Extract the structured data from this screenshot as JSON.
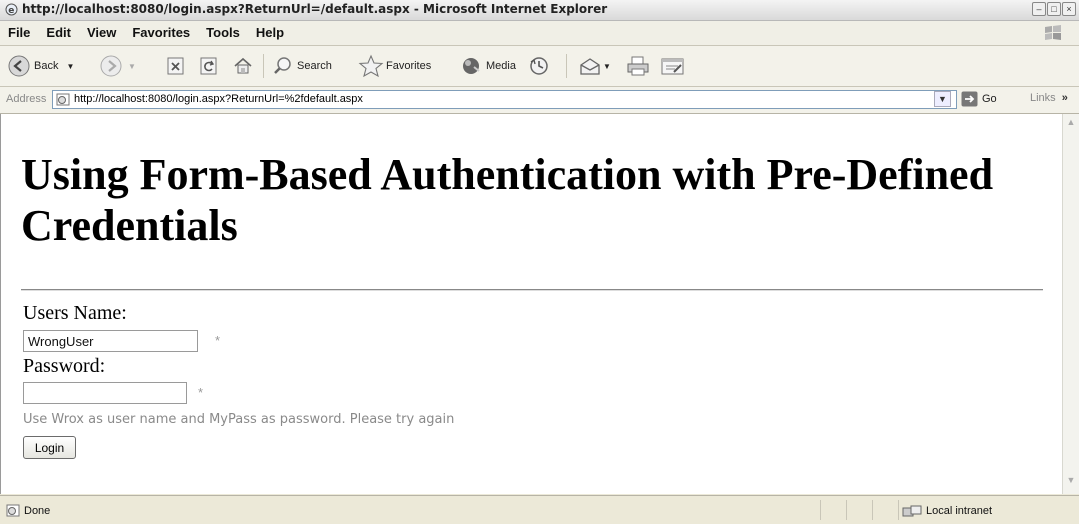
{
  "window": {
    "title": "http://localhost:8080/login.aspx?ReturnUrl=/default.aspx - Microsoft Internet Explorer"
  },
  "menu": [
    "File",
    "Edit",
    "View",
    "Favorites",
    "Tools",
    "Help"
  ],
  "toolbar": {
    "back": "Back",
    "search": "Search",
    "favorites": "Favorites",
    "media": "Media"
  },
  "address": {
    "label": "Address",
    "url": "http://localhost:8080/login.aspx?ReturnUrl=%2fdefault.aspx",
    "go": "Go",
    "links": "Links",
    "links_more": "»"
  },
  "page": {
    "title": "Using Form-Based Authentication with Pre-Defined Credentials",
    "username_label": "Users Name:",
    "username_value": "WrongUser",
    "password_label": "Password:",
    "password_value": "",
    "required_marker": "*",
    "hint": "Use Wrox as user name and MyPass as password. Please try again",
    "login_button": "Login"
  },
  "status": {
    "text": "Done",
    "zone": "Local intranet"
  }
}
